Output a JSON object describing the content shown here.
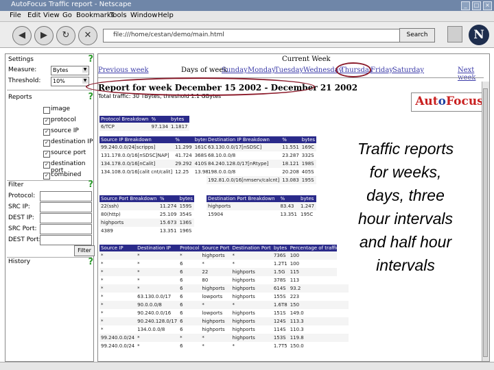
{
  "window": {
    "title": "AutoFocus Traffic report - Netscape",
    "min": "_",
    "max": "□",
    "close": "×"
  },
  "menu": [
    "File",
    "Edit",
    "View",
    "Go",
    "Bookmarks",
    "Tools",
    "Window",
    "Help"
  ],
  "toolbar": {
    "url": "file:///home/cestan/demo/main.html",
    "search_label": "Search",
    "back_glyph": "◀",
    "forward_glyph": "▶",
    "reload_glyph": "↻",
    "stop_glyph": "✕",
    "brand": "N"
  },
  "left": {
    "settings_label": "Settings",
    "help_glyph": "?",
    "measure_label": "Measure:",
    "measure_value": "Bytes",
    "threshold_label": "Threshold:",
    "threshold_value": "10%",
    "reports_label": "Reports",
    "reports": [
      {
        "label": "image",
        "checked": false,
        "mark": ""
      },
      {
        "label": "protocol",
        "checked": true,
        "mark": "✓"
      },
      {
        "label": "source IP",
        "checked": true,
        "mark": "✓"
      },
      {
        "label": "destination IP",
        "checked": true,
        "mark": "✓"
      },
      {
        "label": "source port",
        "checked": true,
        "mark": "✓"
      },
      {
        "label": "destination port",
        "checked": true,
        "mark": "✓"
      },
      {
        "label": "combined",
        "checked": true,
        "mark": "✓"
      }
    ],
    "filter_label": "Filter",
    "filter_fields": [
      "Protocol:",
      "SRC IP:",
      "DEST IP:",
      "SRC Port:",
      "DEST Port:"
    ],
    "filter_button": "Filter",
    "history_label": "History"
  },
  "main": {
    "current_week": "Current Week",
    "previous_week": "Previous week",
    "days_of_week": "Days of week",
    "days": [
      "Sunday",
      "Monday",
      "Tuesday",
      "Wednesday",
      "Thursday",
      "Friday",
      "Saturday"
    ],
    "next_week": "Next week",
    "report_title": "Report for week December 15 2002 - December 21 2002",
    "total_line": "Total traffic: 30 TBytes, threshold 1.1 GBytes",
    "logo_a": "Aut",
    "logo_o": "o",
    "logo_b": "Focus"
  },
  "tables": {
    "protocol": {
      "headers": [
        "Protocol Breakdown",
        "%",
        "bytes"
      ],
      "rows": [
        [
          "6/TCP",
          "97.134",
          "1.1817"
        ]
      ]
    },
    "source_ip": {
      "headers": [
        "Source IP Breakdown",
        "%",
        "bytes"
      ],
      "rows": [
        [
          "99.240.0.0/24[scripps]",
          "11.299",
          "161C"
        ],
        [
          "131.178.0.0/16[nSDSC]NAP]",
          "41.724",
          "368S"
        ],
        [
          "134.178.0.0/16[nCalit]",
          "29.292",
          "410S"
        ],
        [
          "134.108.0.0/16[calit cnt/calit]",
          "12.25",
          "13.98"
        ]
      ]
    },
    "dest_ip": {
      "headers": [
        "Destination IP Breakdown",
        "%",
        "bytes"
      ],
      "rows": [
        [
          "63.130.0.0/17[nSDSC]",
          "11.551",
          "169C"
        ],
        [
          "68.10.0.0/8",
          "23.287",
          "332S"
        ],
        [
          "84.240.128.0/17[nRtype]",
          "18.121",
          "198S"
        ],
        [
          "198.0.0.0/8",
          "20.208",
          "405S"
        ],
        [
          "192.81.0.0/16[nmserv/calcnt]",
          "13.083",
          "195S"
        ]
      ]
    },
    "source_port": {
      "headers": [
        "Source Port Breakdown",
        "%",
        "bytes"
      ],
      "rows": [
        [
          "22(ssh)",
          "11.274",
          "159S"
        ],
        [
          "80(http)",
          "25.109",
          "354S"
        ],
        [
          "highports",
          "15.673",
          "136S"
        ],
        [
          "4389",
          "13.351",
          "196S"
        ]
      ]
    },
    "dest_port": {
      "headers": [
        "Destination Port Breakdown",
        "%",
        "bytes"
      ],
      "rows": [
        [
          "highports",
          "83.43",
          "1.247"
        ],
        [
          "15904",
          "13.351",
          "195C"
        ]
      ]
    },
    "combined": {
      "headers": [
        "Source IP",
        "Destination IP",
        "Protocol",
        "Source Port",
        "Destination Port",
        "bytes",
        "Percentage of traffic(%)"
      ],
      "rows": [
        [
          "*",
          "*",
          "*",
          "highports",
          "*",
          "736S",
          "100"
        ],
        [
          "*",
          "*",
          "6",
          "*",
          "*",
          "1.2T1",
          "100"
        ],
        [
          "*",
          "*",
          "6",
          "22",
          "highports",
          "1.5G",
          "115"
        ],
        [
          "*",
          "*",
          "6",
          "80",
          "highports",
          "378S",
          "113"
        ],
        [
          "*",
          "*",
          "6",
          "highports",
          "highports",
          "614S",
          "93.2"
        ],
        [
          "*",
          "63.130.0.0/17",
          "6",
          "lowports",
          "highports",
          "155S",
          "223"
        ],
        [
          "*",
          "90.0.0.0/8",
          "6",
          "*",
          "*",
          "1.6T8",
          "150"
        ],
        [
          "*",
          "90.240.0.0/16",
          "6",
          "lowports",
          "highports",
          "151S",
          "149.0"
        ],
        [
          "*",
          "90.240.128.0/17",
          "6",
          "highports",
          "highports",
          "124S",
          "113.3"
        ],
        [
          "*",
          "134.0.0.0/8",
          "6",
          "highports",
          "highports",
          "114S",
          "110.3"
        ],
        [
          "99.240.0.0/24",
          "*",
          "*",
          "*",
          "highports",
          "153S",
          "119.8"
        ],
        [
          "99.240.0.0/24",
          "*",
          "6",
          "*",
          "*",
          "1.7T5",
          "150.0"
        ]
      ]
    }
  },
  "callout": [
    "Traffic reports",
    "for weeks,",
    "days, three",
    "hour intervals",
    "and half hour",
    "intervals"
  ],
  "colors": {
    "table_header": "#2a2a8a",
    "oval": "#8b1a2a",
    "link": "#3a3aa8"
  }
}
